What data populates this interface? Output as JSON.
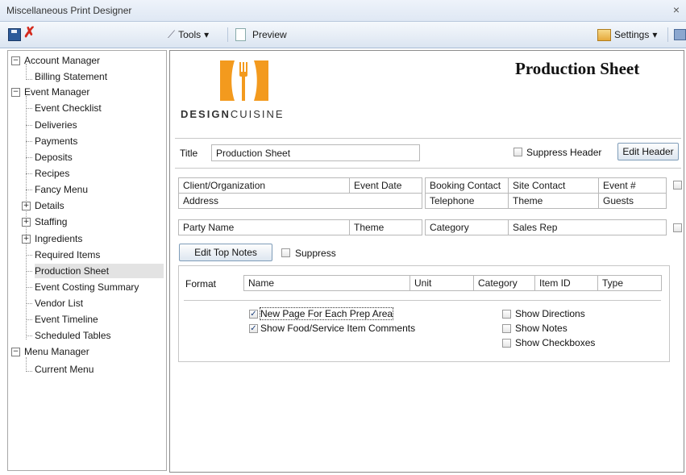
{
  "window": {
    "title": "Miscellaneous Print Designer",
    "close_glyph": "×"
  },
  "toolbar": {
    "tools": "Tools",
    "preview": "Preview",
    "settings": "Settings"
  },
  "tree": {
    "account_manager": "Account Manager",
    "billing_statement": "Billing Statement",
    "event_manager": "Event Manager",
    "event_items": [
      "Event Checklist",
      "Deliveries",
      "Payments",
      "Deposits",
      "Recipes",
      "Fancy Menu"
    ],
    "details": "Details",
    "staffing": "Staffing",
    "ingredients": "Ingredients",
    "event_items2": [
      "Required Items",
      "Production Sheet",
      "Event Costing Summary",
      "Vendor List",
      "Event Timeline",
      "Scheduled Tables"
    ],
    "menu_manager": "Menu Manager",
    "current_menu": "Current Menu",
    "selected": "Production Sheet"
  },
  "header": {
    "logo_bold": "DESIGN",
    "logo_light": "CUISINE",
    "doc_title": "Production Sheet"
  },
  "title_row": {
    "label": "Title",
    "value": "Production Sheet",
    "suppress_header": "Suppress Header",
    "edit_header": "Edit Header"
  },
  "info_grid": {
    "row1": [
      "Client/Organization",
      "Event Date",
      "Booking Contact",
      "Site Contact",
      "Event #"
    ],
    "row2": [
      "Address",
      "",
      "Telephone",
      "Theme",
      "Guests"
    ]
  },
  "party_row": [
    "Party Name",
    "Theme",
    "Category",
    "Sales Rep"
  ],
  "top_notes": {
    "edit": "Edit Top Notes",
    "suppress": "Suppress"
  },
  "format": {
    "label": "Format",
    "columns": [
      "Name",
      "Unit",
      "Category",
      "Item ID",
      "Type"
    ],
    "options_left": [
      {
        "label": "New Page For Each Prep Area",
        "checked": true
      },
      {
        "label": "Show Food/Service Item Comments",
        "checked": true
      }
    ],
    "options_right": [
      {
        "label": "Show Directions",
        "checked": false
      },
      {
        "label": "Show Notes",
        "checked": false
      },
      {
        "label": "Show Checkboxes",
        "checked": false
      }
    ]
  },
  "colors": {
    "accent_orange": "#f39a1e",
    "delete_red": "#d42a1d",
    "titlebar": "#e4ebf5"
  },
  "icons": {
    "save": "save-icon",
    "delete": "delete-icon",
    "tools": "tools-icon",
    "preview": "page-icon",
    "settings": "settings-icon",
    "expand": "minus-expander",
    "collapse": "plus-expander",
    "check_glyph": "✓",
    "dropdown_glyph": "▾",
    "tools_glyph": "⟋",
    "minus_glyph": "−",
    "plus_glyph": "+"
  }
}
